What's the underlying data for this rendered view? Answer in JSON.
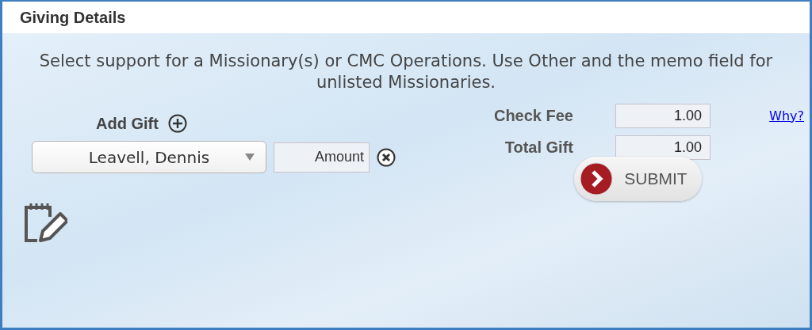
{
  "header": {
    "title": "Giving Details"
  },
  "instructions": "Select support for a Missionary(s) or CMC Operations. Use Other and the memo field for unlisted Missionaries.",
  "add_gift": {
    "label": "Add Gift"
  },
  "gifts": [
    {
      "recipient": "Leavell, Dennis",
      "amount_placeholder": "Amount"
    }
  ],
  "check_fee": {
    "label": "Check Fee",
    "value": "1.00",
    "link": "Why?"
  },
  "total_gift": {
    "label": "Total Gift",
    "value": "1.00"
  },
  "submit": {
    "label": "SUBMIT"
  }
}
